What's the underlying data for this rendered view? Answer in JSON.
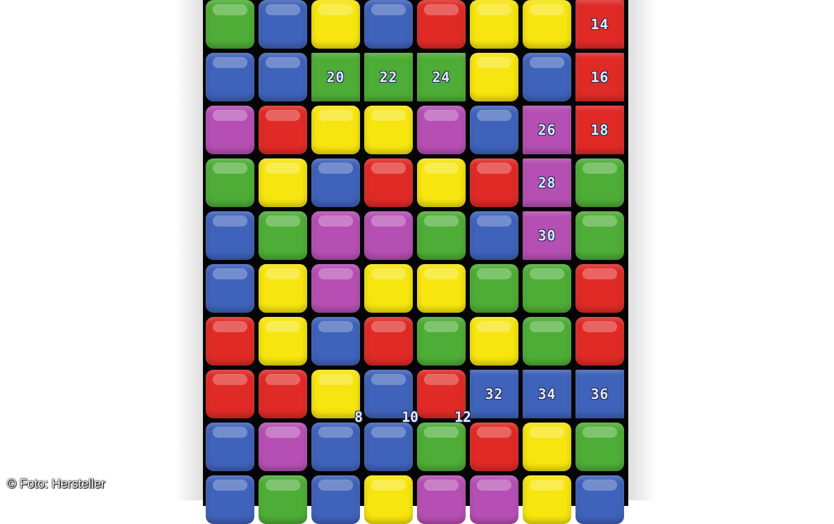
{
  "credit": "© Foto: Hersteller",
  "colors": {
    "red": "#e02a26",
    "blue": "#3f62ba",
    "green": "#4ead36",
    "yellow": "#f6e50e",
    "purple": "#b64fb3",
    "background": "#050505"
  },
  "grid": {
    "rows": 10,
    "cols": 8,
    "cells": [
      [
        {
          "c": "green"
        },
        {
          "c": "blue"
        },
        {
          "c": "yellow"
        },
        {
          "c": "blue"
        },
        {
          "c": "red"
        },
        {
          "c": "yellow"
        },
        {
          "c": "yellow"
        },
        {
          "c": "red",
          "n": "14"
        }
      ],
      [
        {
          "c": "blue"
        },
        {
          "c": "blue"
        },
        {
          "c": "green",
          "n": "20"
        },
        {
          "c": "green",
          "n": "22"
        },
        {
          "c": "green",
          "n": "24"
        },
        {
          "c": "yellow"
        },
        {
          "c": "blue"
        },
        {
          "c": "red",
          "n": "16"
        }
      ],
      [
        {
          "c": "purple"
        },
        {
          "c": "red"
        },
        {
          "c": "yellow"
        },
        {
          "c": "yellow"
        },
        {
          "c": "purple"
        },
        {
          "c": "blue"
        },
        {
          "c": "purple",
          "n": "26"
        },
        {
          "c": "red",
          "n": "18"
        }
      ],
      [
        {
          "c": "green"
        },
        {
          "c": "yellow"
        },
        {
          "c": "blue"
        },
        {
          "c": "red"
        },
        {
          "c": "yellow"
        },
        {
          "c": "red"
        },
        {
          "c": "purple",
          "n": "28"
        },
        {
          "c": "green"
        }
      ],
      [
        {
          "c": "blue"
        },
        {
          "c": "green"
        },
        {
          "c": "purple"
        },
        {
          "c": "purple"
        },
        {
          "c": "green"
        },
        {
          "c": "blue"
        },
        {
          "c": "purple",
          "n": "30"
        },
        {
          "c": "green"
        }
      ],
      [
        {
          "c": "blue"
        },
        {
          "c": "yellow"
        },
        {
          "c": "purple"
        },
        {
          "c": "yellow"
        },
        {
          "c": "yellow"
        },
        {
          "c": "green"
        },
        {
          "c": "green"
        },
        {
          "c": "red"
        }
      ],
      [
        {
          "c": "red"
        },
        {
          "c": "yellow"
        },
        {
          "c": "blue"
        },
        {
          "c": "red"
        },
        {
          "c": "green"
        },
        {
          "c": "yellow"
        },
        {
          "c": "green"
        },
        {
          "c": "red"
        }
      ],
      [
        {
          "c": "red"
        },
        {
          "c": "red"
        },
        {
          "c": "yellow"
        },
        {
          "c": "blue"
        },
        {
          "c": "red"
        },
        {
          "c": "blue",
          "n": "32"
        },
        {
          "c": "blue",
          "n": "34"
        },
        {
          "c": "blue",
          "n": "36"
        }
      ],
      [
        {
          "c": "blue"
        },
        {
          "c": "purple"
        },
        {
          "c": "blue"
        },
        {
          "c": "blue"
        },
        {
          "c": "green"
        },
        {
          "c": "red"
        },
        {
          "c": "yellow"
        },
        {
          "c": "green"
        }
      ],
      [
        {
          "c": "blue"
        },
        {
          "c": "green"
        },
        {
          "c": "blue"
        },
        {
          "c": "yellow"
        },
        {
          "c": "purple"
        },
        {
          "c": "purple"
        },
        {
          "c": "yellow"
        },
        {
          "c": "blue"
        }
      ]
    ]
  },
  "floating_numbers": [
    "8",
    "10",
    "12"
  ]
}
